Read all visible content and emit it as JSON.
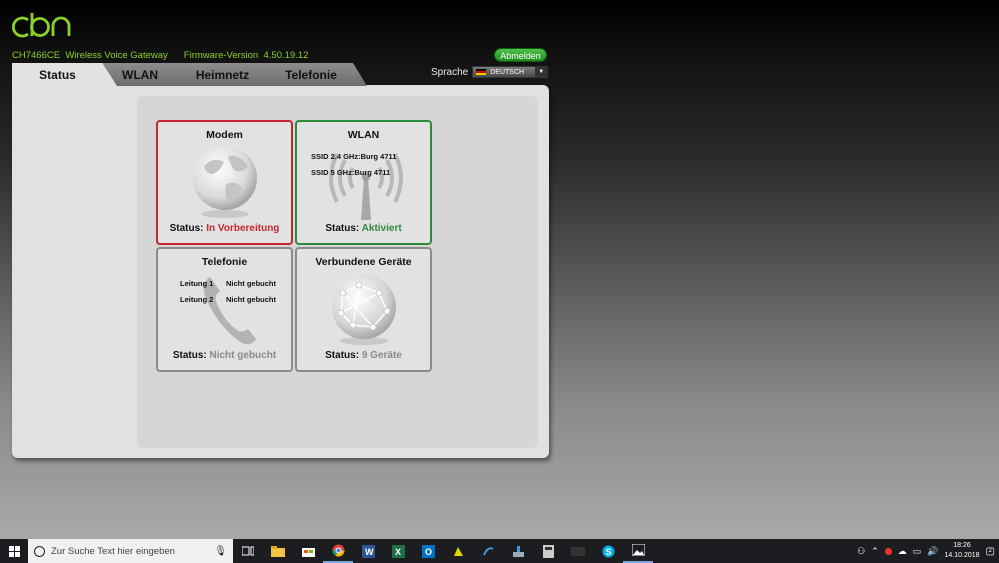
{
  "header": {
    "logo_text": "cbn",
    "model": "CH7466CE",
    "product": "Wireless Voice Gateway",
    "firmware_label": "Firmware-Version",
    "firmware_version": "4.50.19.12",
    "logout_label": "Abmelden"
  },
  "tabs": [
    {
      "label": "Status",
      "active": true
    },
    {
      "label": "WLAN",
      "active": false
    },
    {
      "label": "Heimnetz",
      "active": false
    },
    {
      "label": "Telefonie",
      "active": false
    }
  ],
  "language": {
    "label": "Sprache",
    "selected": "DEUTSCH"
  },
  "cards": {
    "modem": {
      "title": "Modem",
      "status_label": "Status:",
      "status_value": "In Vorbereitung",
      "icon": "globe-icon"
    },
    "wlan": {
      "title": "WLAN",
      "ssid_24": "SSID 2.4 GHz:Burg 4711",
      "ssid_5": "SSID 5 GHz:Burg 4711",
      "status_label": "Status:",
      "status_value": "Aktiviert",
      "icon": "antenna-icon"
    },
    "telefonie": {
      "title": "Telefonie",
      "line1_label": "Leitung 1",
      "line1_value": "Nicht gebucht",
      "line2_label": "Leitung 2",
      "line2_value": "Nicht gebucht",
      "status_label": "Status:",
      "status_value": "Nicht gebucht",
      "icon": "phone-icon"
    },
    "devices": {
      "title": "Verbundene Geräte",
      "status_label": "Status:",
      "status_value": "9 Geräte",
      "icon": "network-globe-icon"
    }
  },
  "colors": {
    "accent_green": "#8bd12a",
    "status_red": "#c3262c",
    "status_green": "#2f8a3c"
  },
  "taskbar": {
    "search_placeholder": "Zur Suche Text hier eingeben",
    "time": "18:26",
    "date": "14.10.2018",
    "notification_count": "2"
  }
}
